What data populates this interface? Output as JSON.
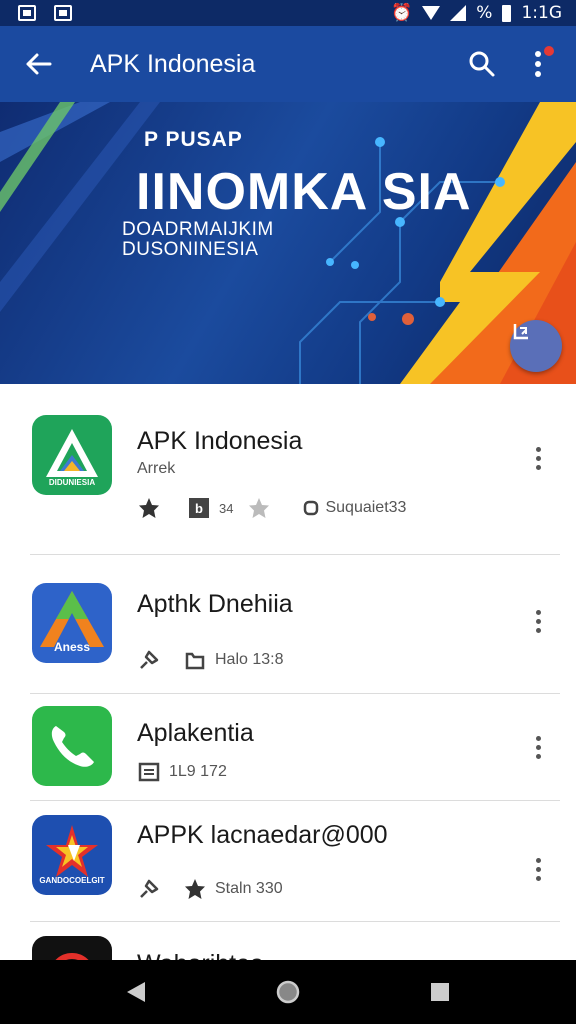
{
  "status_bar": {
    "time": "1:1G",
    "battery": "%"
  },
  "app_bar": {
    "title": "APK Indonesia"
  },
  "banner": {
    "subtitle_top": "P PUSAP",
    "title": "IINOMKA SIA",
    "subtitle_line1": "DOADRMAIJKIM",
    "subtitle_line2": "DUSONINESIA"
  },
  "apps": [
    {
      "name": "APK Indonesia",
      "developer": "Arrek",
      "icon": "apk-indonesia-icon",
      "icon_label": "DIDUNIESIA",
      "meta": [
        {
          "icon": "star-icon",
          "text": ""
        },
        {
          "icon": "file-b-icon",
          "text": "34"
        },
        {
          "icon": "star-outline-icon",
          "text": ""
        },
        {
          "icon": "circle-icon",
          "text": "Suquaiet33"
        }
      ]
    },
    {
      "name": "Apthk Dnehiia",
      "icon": "apthk-icon",
      "icon_label": "Aness",
      "meta": [
        {
          "icon": "pin-icon",
          "text": ""
        },
        {
          "icon": "folder-icon",
          "text": "Halo 13:8"
        }
      ]
    },
    {
      "name": "Aplakentia",
      "icon": "phone-app-icon",
      "meta": [
        {
          "icon": "doc-icon",
          "text": "1L9 172"
        }
      ]
    },
    {
      "name": "APPK lacnaedar@000",
      "icon": "appk-icon",
      "icon_label": "GANDOCOELGIT",
      "meta": [
        {
          "icon": "pin-icon",
          "text": ""
        },
        {
          "icon": "star-icon",
          "text": "Staln 330"
        }
      ]
    },
    {
      "name": "Wahorihtea",
      "icon": "wahorihtea-icon"
    }
  ],
  "colors": {
    "app_bar": "#1b4aa0",
    "status_bar": "#0d2a66",
    "banner_orange": "#f26a1b",
    "banner_yellow": "#f7c325"
  }
}
